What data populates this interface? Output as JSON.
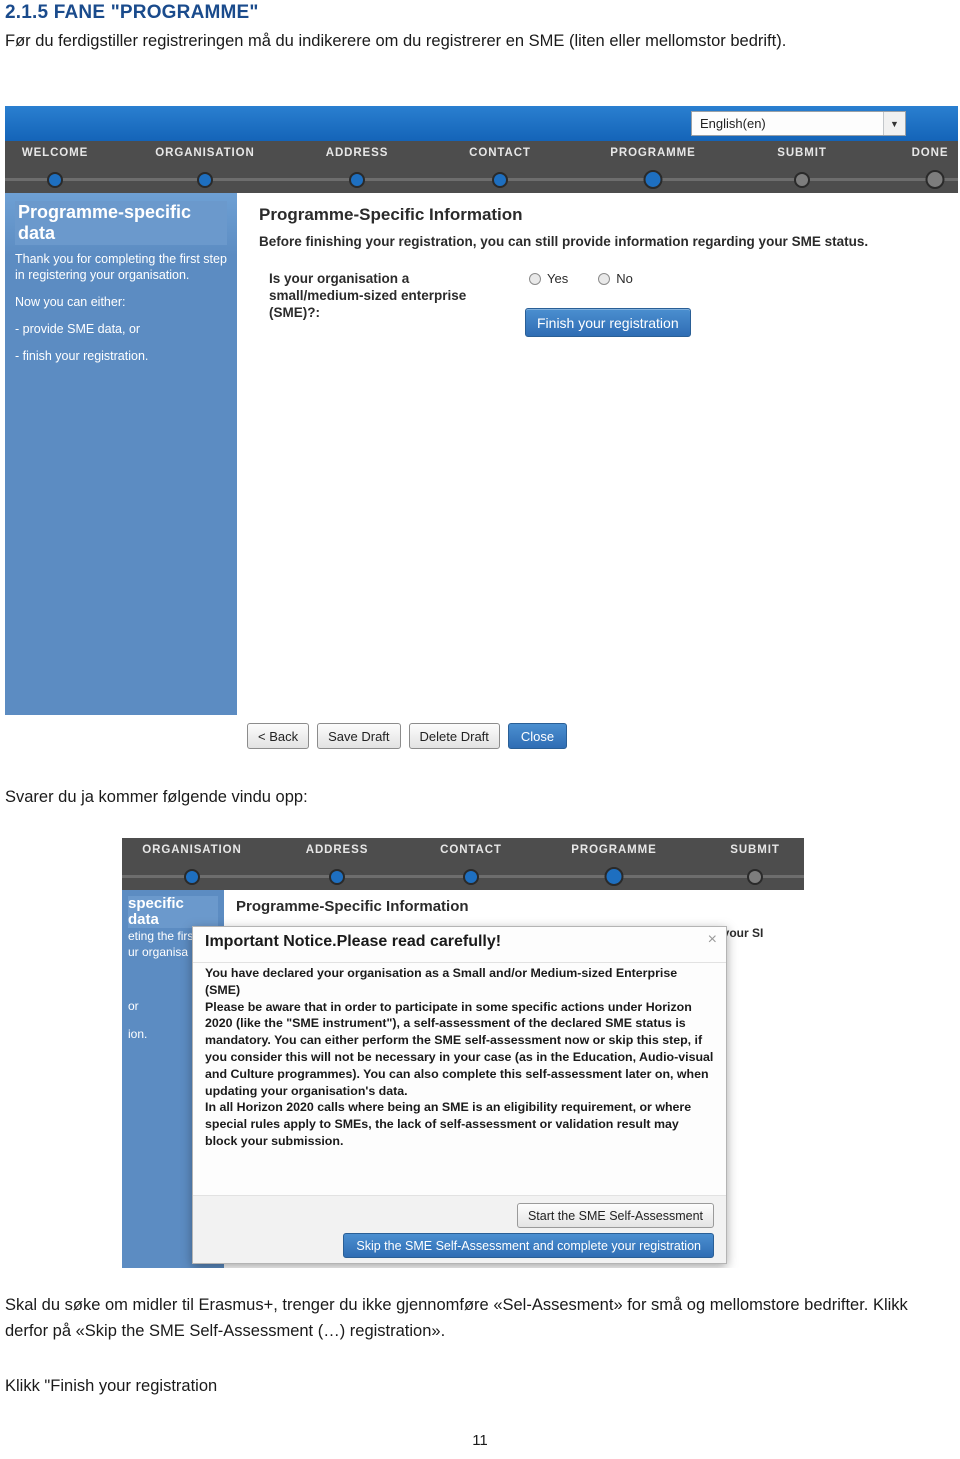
{
  "document": {
    "heading": "2.1.5 FANE \"PROGRAMME\"",
    "intro": "Før du ferdigstiller registreringen må du indikerere om du registrerer en SME (liten eller mellomstor bedrift).",
    "caption_after_first_shot": "Svarer du ja kommer følgende vindu opp:",
    "caption_after_second_shot": "Skal du søke om midler til Erasmus+, trenger du ikke gjennomføre «Sel-Assesment» for små og mellomstore bedrifter. Klikk derfor på «Skip the SME Self-Assessment (…) registration».",
    "caption_final": "Klikk \"Finish your registration",
    "page_number": "11"
  },
  "screenshot1": {
    "language_selector": {
      "value": "English(en)",
      "caret": "▼"
    },
    "steps": [
      {
        "label": "WELCOME",
        "state": "done"
      },
      {
        "label": "ORGANISATION",
        "state": "done"
      },
      {
        "label": "ADDRESS",
        "state": "done"
      },
      {
        "label": "CONTACT",
        "state": "done"
      },
      {
        "label": "PROGRAMME",
        "state": "active"
      },
      {
        "label": "SUBMIT",
        "state": "pending"
      },
      {
        "label": "DONE",
        "state": "pending"
      }
    ],
    "left_panel": {
      "title": "Programme-specific data",
      "line1": "Thank you for completing the first step in registering your organisation.",
      "line2": "Now you can either:",
      "line3": "- provide SME data, or",
      "line4": "- finish your registration."
    },
    "right_panel": {
      "title": "Programme-Specific Information",
      "subtitle": "Before finishing your registration, you can still provide information regarding your SME status.",
      "question": "Is your organisation a small/medium-sized enterprise (SME)?:",
      "radio_yes": "Yes",
      "radio_no": "No",
      "finish_button": "Finish your registration"
    },
    "bottom_buttons": {
      "back": "< Back",
      "save_draft": "Save Draft",
      "delete_draft": "Delete Draft",
      "close": "Close"
    }
  },
  "screenshot2": {
    "steps": [
      {
        "label": "ORGANISATION",
        "state": "done"
      },
      {
        "label": "ADDRESS",
        "state": "done"
      },
      {
        "label": "CONTACT",
        "state": "done"
      },
      {
        "label": "PROGRAMME",
        "state": "active"
      },
      {
        "label": "SUBMIT",
        "state": "pending"
      }
    ],
    "left_panel_fragment": {
      "title": "specific data",
      "line1": "eting the firs",
      "line2": "ur organisa",
      "line3": "or",
      "line4": "ion."
    },
    "right_panel": {
      "title": "Programme-Specific Information",
      "subtitle": "ding your SI"
    },
    "modal": {
      "title_plain": "Important Notice.",
      "title_underlined": "Please read carefully!",
      "close_icon": "×",
      "paragraph1": "You have declared your organisation as a Small and/or Medium-sized Enterprise (SME)",
      "paragraph2": "Please be aware that in order to participate in some specific actions under Horizon 2020 (like the \"SME instrument\"), a self-assessment of the declared SME status is mandatory. You can either perform the SME self-assessment now or skip this step, if you consider this will not be necessary in your case (as in the Education, Audio-visual and Culture programmes). You can also complete this self-assessment later on, when updating your organisation's data.",
      "paragraph3": "In all Horizon 2020 calls where being an SME is an eligibility requirement, or where special rules apply to SMEs, the lack of self-assessment or validation result may block your submission.",
      "button_start": "Start the SME Self-Assessment",
      "button_skip": "Skip the SME Self-Assessment and complete your registration"
    }
  },
  "colors": {
    "heading_blue": "#1a4b8c",
    "topbar_blue": "#1c6fc4",
    "stepbar_grey": "#4d4d4d",
    "panel_blue": "#5c8cc2",
    "dot_active": "#1e6fc0",
    "dot_pending": "#7d7d7d"
  }
}
